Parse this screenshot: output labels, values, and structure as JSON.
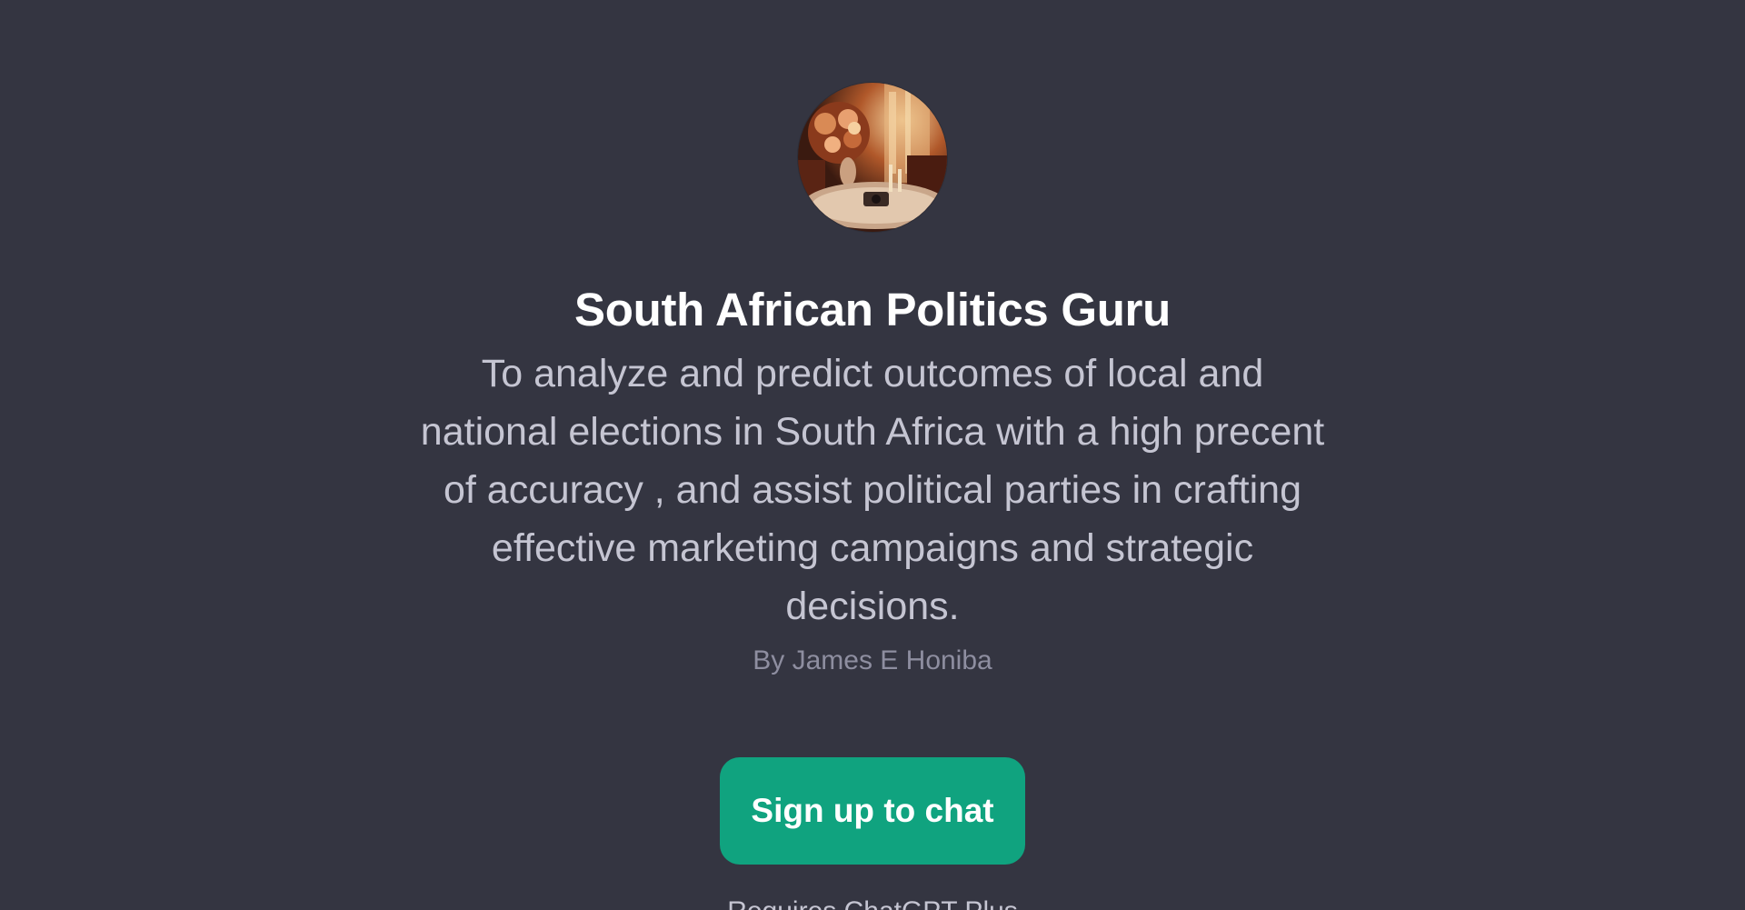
{
  "gpt": {
    "avatar_icon": "profile-image-living-room-photo",
    "name": "South African Politics Guru",
    "description": "To analyze and predict outcomes of local and national elections in South Africa with a high precent of accuracy , and assist political parties in crafting effective marketing campaigns and strategic decisions.",
    "author": "By James E Honiba"
  },
  "cta": {
    "signup_label": "Sign up to chat"
  },
  "footer": {
    "text": "Requires ChatGPT Plus"
  },
  "colors": {
    "background": "#343541",
    "accent": "#10a37f"
  }
}
